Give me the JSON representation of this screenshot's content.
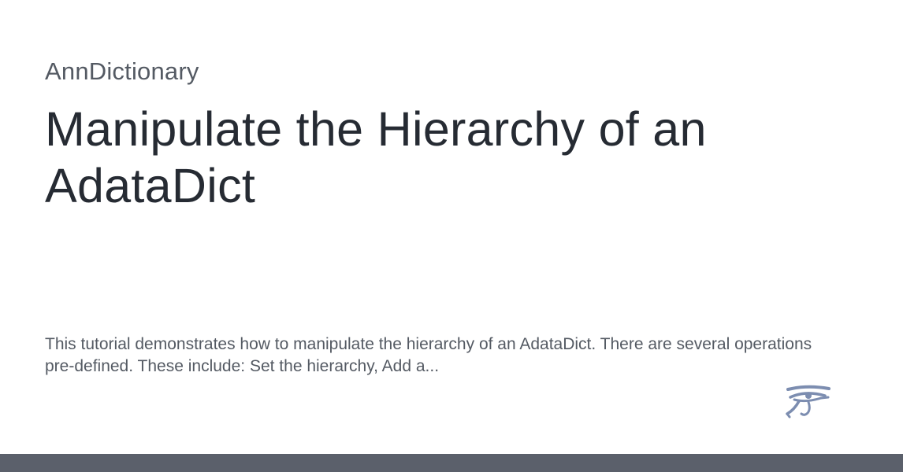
{
  "card": {
    "site_name": "AnnDictionary",
    "title": "Manipulate the Hierarchy of an AdataDict",
    "description": "This tutorial demonstrates how to manipulate the hierarchy of an AdataDict. There are several operations pre-defined. These include: Set the hierarchy, Add a...",
    "logo_icon": "eye-of-horus-icon"
  },
  "colors": {
    "background": "#ffffff",
    "title": "#262b33",
    "text": "#545a63",
    "logo": "#7c8db0",
    "bottom_bar": "#5b606b"
  }
}
